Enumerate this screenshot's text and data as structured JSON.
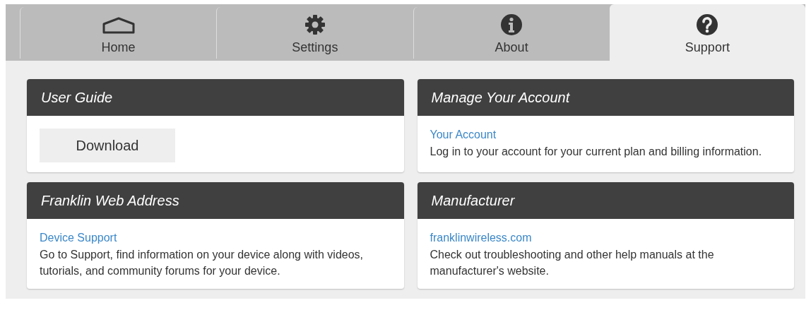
{
  "tabs": [
    {
      "label": "Home",
      "kind": "home",
      "selected": false
    },
    {
      "label": "Settings",
      "kind": "gear",
      "selected": false
    },
    {
      "label": "About",
      "kind": "info",
      "selected": false
    },
    {
      "label": "Support",
      "kind": "help",
      "selected": true
    }
  ],
  "cards": [
    {
      "title": "User Guide",
      "kind": "button",
      "button": "Download"
    },
    {
      "title": "Manage Your Account",
      "kind": "link",
      "link": "Your Account",
      "description": "Log in to your account for your current plan and billing information."
    },
    {
      "title": "Franklin Web Address",
      "kind": "link",
      "link": "Device Support",
      "description": "Go to Support, find information on your device along with videos, tutorials, and community forums for your device."
    },
    {
      "title": "Manufacturer",
      "kind": "link",
      "link": "franklinwireless.com",
      "description": "Check out troubleshooting and other help manuals at the manufacturer's website."
    }
  ]
}
